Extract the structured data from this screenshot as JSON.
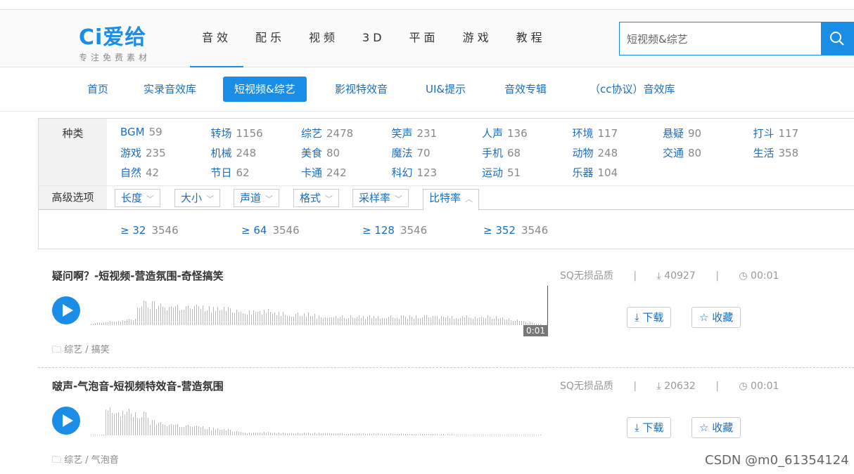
{
  "logo": {
    "mark": "Ci爱给",
    "tagline": "专注免费素材"
  },
  "main_nav": [
    "音效",
    "配乐",
    "视频",
    "3D",
    "平面",
    "游戏",
    "教程"
  ],
  "main_nav_active": 0,
  "search": {
    "value": "短视频&综艺",
    "icon": "search-icon"
  },
  "sub_nav": [
    "首页",
    "实录音效库",
    "短视频&综艺",
    "影视特效音",
    "UI&提示",
    "音效专辑",
    "（cc协议）音效库"
  ],
  "sub_nav_active": 2,
  "filter": {
    "category_label": "种类",
    "categories": [
      {
        "name": "BGM",
        "count": "59"
      },
      {
        "name": "转场",
        "count": "1156"
      },
      {
        "name": "综艺",
        "count": "2478"
      },
      {
        "name": "笑声",
        "count": "231"
      },
      {
        "name": "人声",
        "count": "136"
      },
      {
        "name": "环境",
        "count": "117"
      },
      {
        "name": "悬疑",
        "count": "90"
      },
      {
        "name": "打斗",
        "count": "117"
      },
      {
        "name": "游戏",
        "count": "235"
      },
      {
        "name": "机械",
        "count": "248"
      },
      {
        "name": "美食",
        "count": "80"
      },
      {
        "name": "魔法",
        "count": "70"
      },
      {
        "name": "手机",
        "count": "68"
      },
      {
        "name": "动物",
        "count": "248"
      },
      {
        "name": "交通",
        "count": "80"
      },
      {
        "name": "生活",
        "count": "358"
      },
      {
        "name": "自然",
        "count": "42"
      },
      {
        "name": "节日",
        "count": "62"
      },
      {
        "name": "卡通",
        "count": "242"
      },
      {
        "name": "科幻",
        "count": "123"
      },
      {
        "name": "运动",
        "count": "51"
      },
      {
        "name": "乐器",
        "count": "104"
      }
    ],
    "advanced_label": "高级选项",
    "dropdowns": [
      "长度",
      "大小",
      "声道",
      "格式",
      "采样率",
      "比特率"
    ],
    "dropdown_open": 5,
    "bitrates": [
      {
        "name": "≥ 32",
        "count": "3546"
      },
      {
        "name": "≥ 64",
        "count": "3546"
      },
      {
        "name": "≥ 128",
        "count": "3546"
      },
      {
        "name": "≥ 352",
        "count": "3546"
      }
    ]
  },
  "tracks": [
    {
      "title": "疑问啊？-短视频-营造氛围-奇怪搞笑",
      "quality": "SQ无损品质",
      "downloads": "40927",
      "duration": "00:01",
      "time_label": "0:01",
      "tag": "综艺 / 搞笑",
      "download_label": "下载",
      "favorite_label": "收藏"
    },
    {
      "title": "啵声-气泡音-短视频特效音-营造氛围",
      "quality": "SQ无损品质",
      "downloads": "20632",
      "duration": "00:01",
      "tag": "综艺 / 气泡音",
      "download_label": "下载",
      "favorite_label": "收藏"
    }
  ],
  "watermark": "CSDN @m0_61354124",
  "colors": {
    "accent": "#1a8ee6",
    "link": "#1a6dc2"
  }
}
